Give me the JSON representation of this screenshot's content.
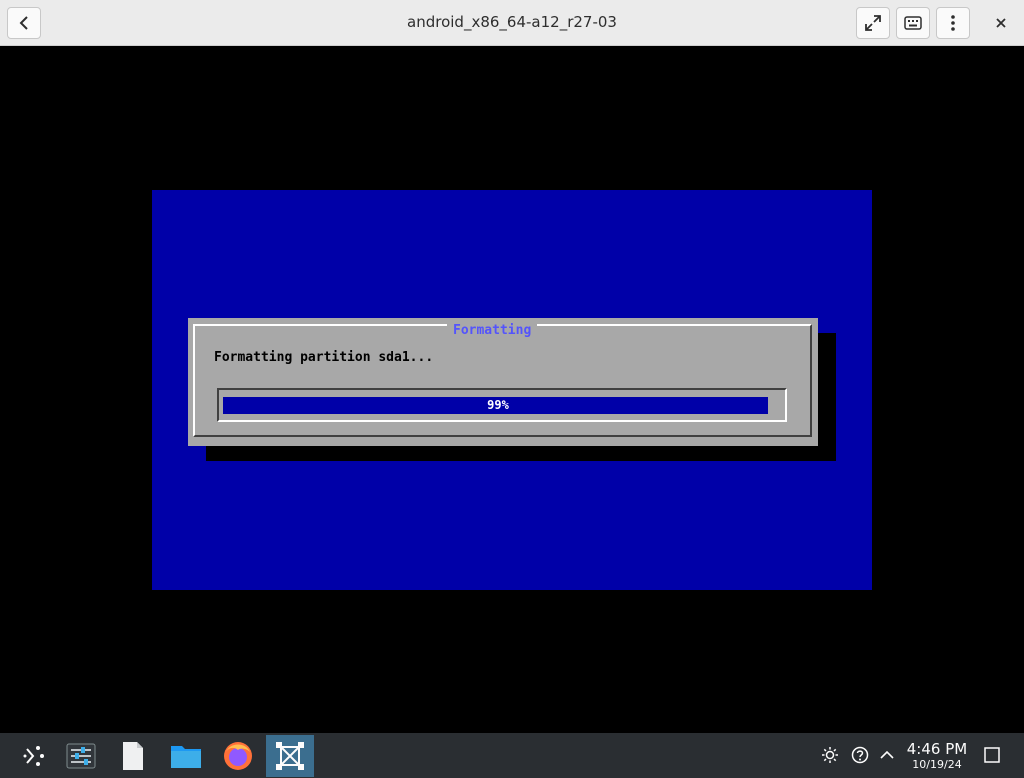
{
  "window": {
    "title": "android_x86_64-a12_r27-03",
    "back_icon": "chevron-left-icon",
    "fullscreen_icon": "expand-arrows-icon",
    "keyboard_icon": "keyboard-icon",
    "menu_icon": "vertical-dots-icon",
    "close_icon": "close-icon"
  },
  "installer": {
    "dialog_title": "Formatting",
    "message": "Formatting partition sda1...",
    "progress_label": "99%",
    "progress_fraction": 0.99,
    "colors": {
      "screen_background": "#0000a8",
      "dialog_background": "#a8a8a8",
      "title_text": "#5454fc",
      "gauge_fill": "#0000a8"
    }
  },
  "taskbar": {
    "launchers": [
      {
        "name": "application-launcher",
        "icon": "kde-launcher-icon"
      },
      {
        "name": "system-settings",
        "icon": "settings-sliders-icon"
      },
      {
        "name": "text-document",
        "icon": "document-icon"
      },
      {
        "name": "file-manager",
        "icon": "folder-icon"
      },
      {
        "name": "firefox",
        "icon": "firefox-icon"
      },
      {
        "name": "virtual-machine-manager",
        "icon": "vm-box-icon",
        "active": true
      }
    ],
    "tray": [
      "brightness-icon",
      "help-icon",
      "chevron-up-icon"
    ],
    "clock": {
      "time": "4:46 PM",
      "date": "10/19/24"
    },
    "show_desktop_icon": "show-desktop-icon"
  }
}
